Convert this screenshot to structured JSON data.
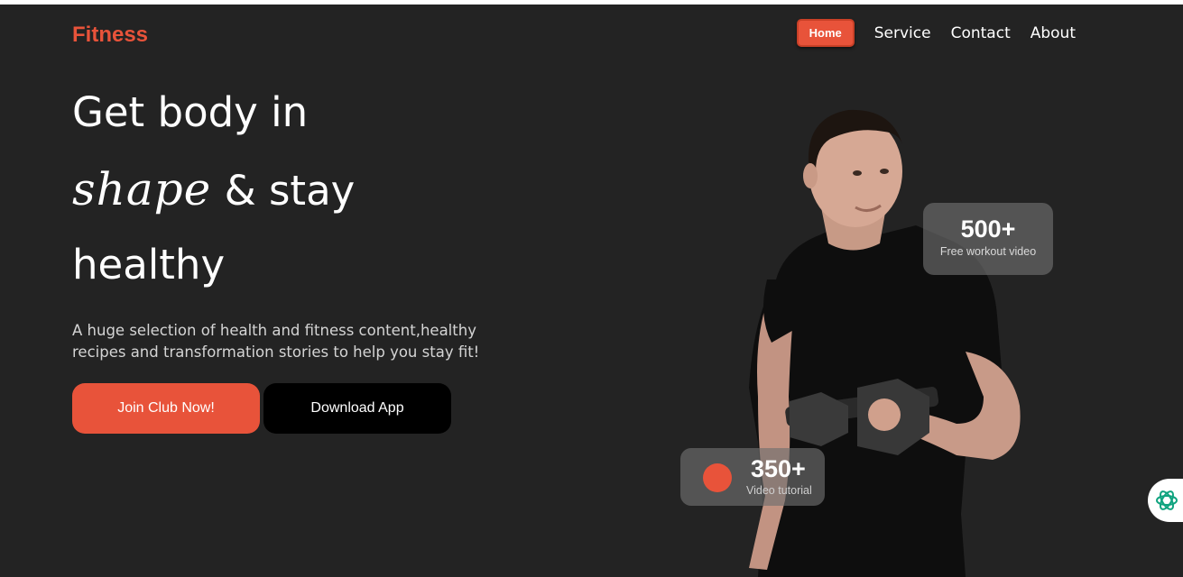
{
  "header": {
    "logo": "Fitness",
    "nav": [
      {
        "label": "Home"
      },
      {
        "label": "Service"
      },
      {
        "label": "Contact"
      },
      {
        "label": "About"
      }
    ]
  },
  "hero": {
    "line1": "Get body in",
    "line2_script": "shape",
    "line2_rest": " & stay",
    "line3": "healthy",
    "description": "A huge selection of health and fitness content,healthy recipes and transformation stories to help you stay fit!",
    "join_label": "Join Club Now!",
    "download_label": "Download App"
  },
  "stats": {
    "workout": {
      "value": "500+",
      "label": "Free workout video"
    },
    "tutorial": {
      "value": "350+",
      "label": "Video tutorial"
    }
  },
  "icons": {
    "chat": "chatgpt-icon"
  },
  "colors": {
    "accent": "#e8533a",
    "background": "#232323",
    "dark_button": "#000000"
  }
}
